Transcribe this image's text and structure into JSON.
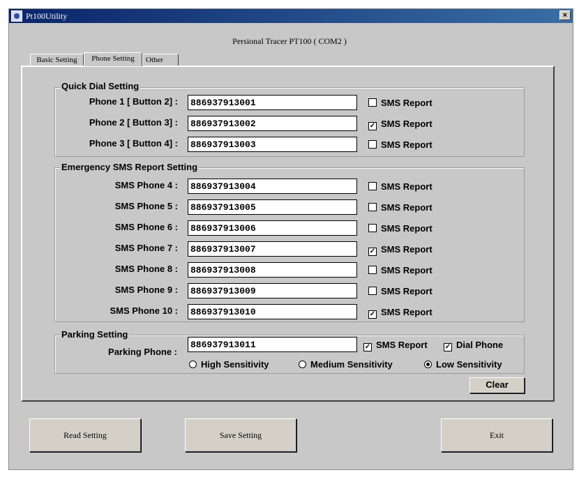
{
  "window": {
    "title": "Pt100Utility",
    "close_label": "×"
  },
  "header": {
    "device_label": "Persional Tracer PT100 ( COM2 )"
  },
  "tabs": [
    {
      "label": "Basic Setting"
    },
    {
      "label": "Phone Setting"
    },
    {
      "label": "Other"
    }
  ],
  "quick_dial": {
    "title": "Quick Dial Setting",
    "rows": [
      {
        "label": "Phone 1 [ Button 2] :",
        "value": "886937913001",
        "sms_label": "SMS Report",
        "sms_checked": false
      },
      {
        "label": "Phone 2 [ Button 3] :",
        "value": "886937913002",
        "sms_label": "SMS Report",
        "sms_checked": true
      },
      {
        "label": "Phone 3 [ Button 4] :",
        "value": "886937913003",
        "sms_label": "SMS Report",
        "sms_checked": false
      }
    ]
  },
  "emergency": {
    "title": "Emergency SMS Report Setting",
    "rows": [
      {
        "label": "SMS Phone 4 :",
        "value": "886937913004",
        "sms_label": "SMS Report",
        "sms_checked": false
      },
      {
        "label": "SMS Phone 5 :",
        "value": "886937913005",
        "sms_label": "SMS Report",
        "sms_checked": false
      },
      {
        "label": "SMS Phone 6 :",
        "value": "886937913006",
        "sms_label": "SMS Report",
        "sms_checked": false
      },
      {
        "label": "SMS Phone 7 :",
        "value": "886937913007",
        "sms_label": "SMS Report",
        "sms_checked": true
      },
      {
        "label": "SMS Phone 8 :",
        "value": "886937913008",
        "sms_label": "SMS Report",
        "sms_checked": false
      },
      {
        "label": "SMS Phone 9 :",
        "value": "886937913009",
        "sms_label": "SMS Report",
        "sms_checked": false
      },
      {
        "label": "SMS Phone 10 :",
        "value": "886937913010",
        "sms_label": "SMS Report",
        "sms_checked": true
      }
    ]
  },
  "parking": {
    "title": "Parking Setting",
    "phone_label": "Parking Phone :",
    "phone_value": "886937913011",
    "sms_label": "SMS Report",
    "sms_checked": true,
    "dial_label": "Dial Phone",
    "dial_checked": true,
    "sensitivity": [
      {
        "label": "High Sensitivity",
        "selected": false
      },
      {
        "label": "Medium Sensitivity",
        "selected": false
      },
      {
        "label": "Low Sensitivity",
        "selected": true
      }
    ],
    "clear_label": "Clear"
  },
  "buttons": {
    "read": "Read Setting",
    "save": "Save Setting",
    "exit": "Exit"
  },
  "check_mark": "✓"
}
